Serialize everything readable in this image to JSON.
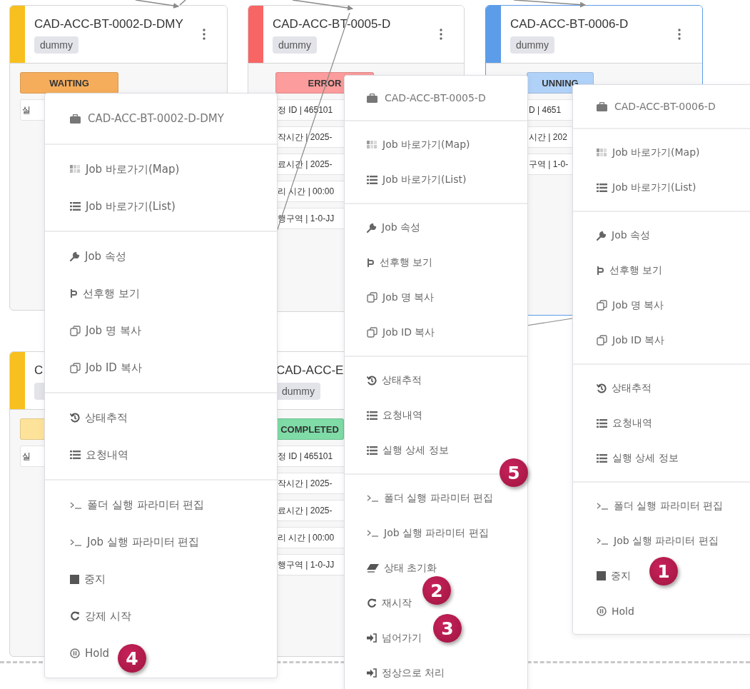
{
  "cards": [
    {
      "title": "CAD-ACC-BT-0002-D-DMY",
      "tag": "dummy",
      "color": "#f8c01e",
      "status": {
        "text": "WAITING",
        "color": "#f5ad5c"
      },
      "selected": false,
      "rows": [
        "실"
      ]
    },
    {
      "title": "CAD-ACC-BT-0005-D",
      "tag": "dummy",
      "color": "#f76565",
      "status": {
        "text": "ERROR",
        "color": "#fc9c9c"
      },
      "selected": false,
      "rows": [
        "정 ID | 465101",
        "작시간 | 2025-",
        "료시간 | 2025-",
        "리 시간 | 00:00",
        "행구역 | 1-0-JJ"
      ]
    },
    {
      "title": "CAD-ACC-BT-0006-D",
      "tag": "dummy",
      "color": "#5c9ce8",
      "status": {
        "text": "UNNING",
        "color": "#b1d2f8"
      },
      "selected": true,
      "rows": [
        "D | 4651",
        "시간 | 202",
        "구역 | 1-0-"
      ]
    },
    {
      "title": "C",
      "color": "#f8c01e",
      "status": {
        "color": "#fde39a"
      },
      "selected": false,
      "rows": [
        "실"
      ]
    },
    {
      "title": "CAD-ACC-E",
      "tag": "dummy",
      "status": {
        "text": "COMPLETED",
        "color": "#7fdca7"
      },
      "selected": false,
      "rows": [
        "정 ID | 465101",
        "작시간 | 2025-",
        "료시간 | 2025-",
        "리 시간 | 00:00",
        "행구역 | 1-0-JJ"
      ]
    }
  ],
  "menus": [
    {
      "header": "CAD-ACC-BT-0002-D-DMY",
      "sections": [
        [
          {
            "kind": "map",
            "label": "Job 바로가기(Map)"
          },
          {
            "kind": "list",
            "label": "Job 바로가기(List)"
          }
        ],
        [
          {
            "kind": "wrench",
            "label": "Job 속성"
          },
          {
            "kind": "branch",
            "label": "선후행 보기"
          },
          {
            "kind": "copy",
            "label": "Job 명 복사"
          },
          {
            "kind": "copy",
            "label": "Job ID 복사"
          }
        ],
        [
          {
            "kind": "history",
            "label": "상태추적"
          },
          {
            "kind": "list",
            "label": "요청내역"
          }
        ],
        [
          {
            "kind": "terminal",
            "label": "폴더 실행 파라미터 편집"
          },
          {
            "kind": "terminal",
            "label": "Job 실행 파라미터 편집"
          },
          {
            "kind": "stop",
            "label": "중지"
          },
          {
            "kind": "restart",
            "label": "강제 시작"
          },
          {
            "kind": "hold",
            "label": "Hold"
          }
        ]
      ]
    },
    {
      "header": "CAD-ACC-BT-0005-D",
      "sections": [
        [
          {
            "kind": "map",
            "label": "Job 바로가기(Map)"
          },
          {
            "kind": "list",
            "label": "Job 바로가기(List)"
          }
        ],
        [
          {
            "kind": "wrench",
            "label": "Job 속성"
          },
          {
            "kind": "branch",
            "label": "선후행 보기"
          },
          {
            "kind": "copy",
            "label": "Job 명 복사"
          },
          {
            "kind": "copy",
            "label": "Job ID 복사"
          }
        ],
        [
          {
            "kind": "history",
            "label": "상태추적"
          },
          {
            "kind": "list",
            "label": "요청내역"
          },
          {
            "kind": "list",
            "label": "실행 상세 정보"
          }
        ],
        [
          {
            "kind": "terminal",
            "label": "폴더 실행 파라미터 편집"
          },
          {
            "kind": "terminal",
            "label": "Job 실행 파라미터 편집"
          },
          {
            "kind": "eraser",
            "label": "상태 초기화"
          },
          {
            "kind": "restart",
            "label": "재시작"
          },
          {
            "kind": "skip",
            "label": "넘어가기"
          },
          {
            "kind": "skip",
            "label": "정상으로 처리"
          }
        ]
      ]
    },
    {
      "header": "CAD-ACC-BT-0006-D",
      "sections": [
        [
          {
            "kind": "map",
            "label": "Job 바로가기(Map)"
          },
          {
            "kind": "list",
            "label": "Job 바로가기(List)"
          }
        ],
        [
          {
            "kind": "wrench",
            "label": "Job 속성"
          },
          {
            "kind": "branch",
            "label": "선후행 보기"
          },
          {
            "kind": "copy",
            "label": "Job 명 복사"
          },
          {
            "kind": "copy",
            "label": "Job ID 복사"
          }
        ],
        [
          {
            "kind": "history",
            "label": "상태추적"
          },
          {
            "kind": "list",
            "label": "요청내역"
          },
          {
            "kind": "list",
            "label": "실행 상세 정보"
          }
        ],
        [
          {
            "kind": "terminal",
            "label": "폴더 실행 파라미터 편집"
          },
          {
            "kind": "terminal",
            "label": "Job 실행 파라미터 편집"
          },
          {
            "kind": "stop",
            "label": "중지"
          },
          {
            "kind": "hold",
            "label": "Hold"
          }
        ]
      ]
    }
  ],
  "callouts": [
    "1",
    "2",
    "3",
    "4",
    "5"
  ]
}
